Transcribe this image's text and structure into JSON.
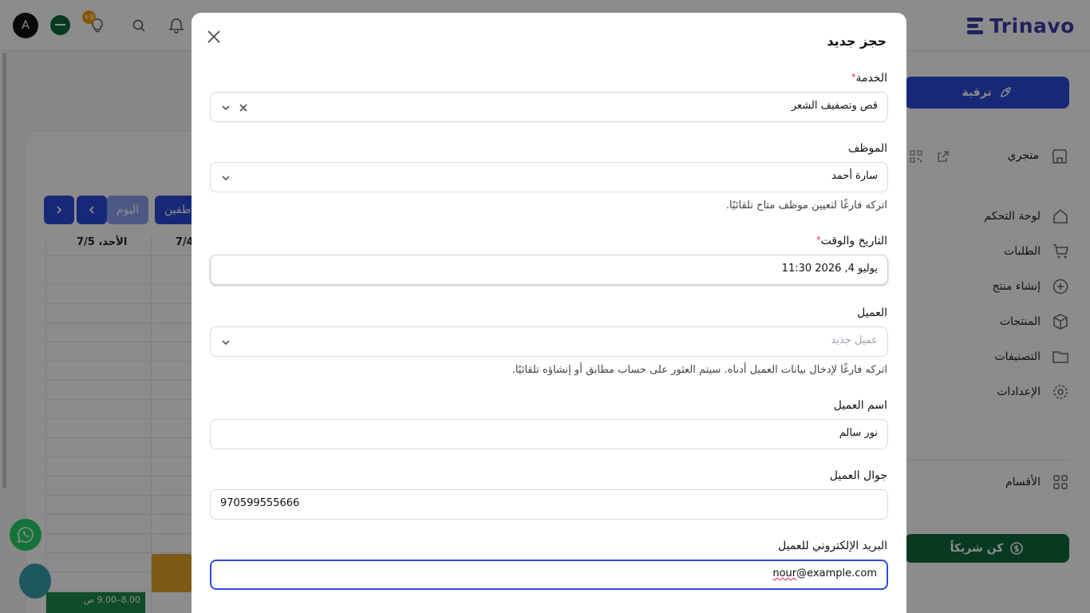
{
  "topbar": {
    "avatar_letter": "A",
    "notification_badge": "+9",
    "logo_text": "Trinavo"
  },
  "sidebar": {
    "upgrade_label": "ترقية",
    "store_label": "متجري",
    "items": [
      {
        "label": "لوحة التحكم",
        "icon": "home-icon"
      },
      {
        "label": "الطلبات",
        "icon": "cart-icon"
      },
      {
        "label": "إنشاء منتج",
        "icon": "plus-circle-icon"
      },
      {
        "label": "المنتجات",
        "icon": "box-icon"
      },
      {
        "label": "التصنيفات",
        "icon": "folder-icon"
      },
      {
        "label": "الإعدادات",
        "icon": "gear-icon"
      }
    ],
    "sections_label": "الأقسام",
    "partner_label": "كن شريكاً"
  },
  "calendar": {
    "today_label": "اليوم",
    "staff_label": "طفين",
    "col_sun": "الأحد، 7/5",
    "col_sat": "7/4",
    "event_time": "8.00–9.00 ص"
  },
  "modal": {
    "title": "حجز جديد",
    "service": {
      "label": "الخدمة",
      "value": "قص وتصفيف الشعر"
    },
    "employee": {
      "label": "الموظف",
      "value": "سارة أحمد",
      "hint": "اتركه فارغًا لتعيين موظف متاح تلقائيًا."
    },
    "datetime": {
      "label": "التاريخ والوقت",
      "value": "يوليو 4, 2026 11:30"
    },
    "customer": {
      "label": "العميل",
      "placeholder": "عميل جديد",
      "hint": "اتركه فارغًا لإدخال بيانات العميل أدناه. سيتم العثور على حساب مطابق أو إنشاؤه تلقائيًا."
    },
    "customer_name": {
      "label": "اسم العميل",
      "value": "نور سالم"
    },
    "customer_phone": {
      "label": "جوال العميل",
      "value": "970599555666"
    },
    "customer_email": {
      "label": "البريد الإلكتروني للعميل",
      "value_user": "nour",
      "value_domain": "@example.com"
    },
    "required_mark": "*"
  }
}
